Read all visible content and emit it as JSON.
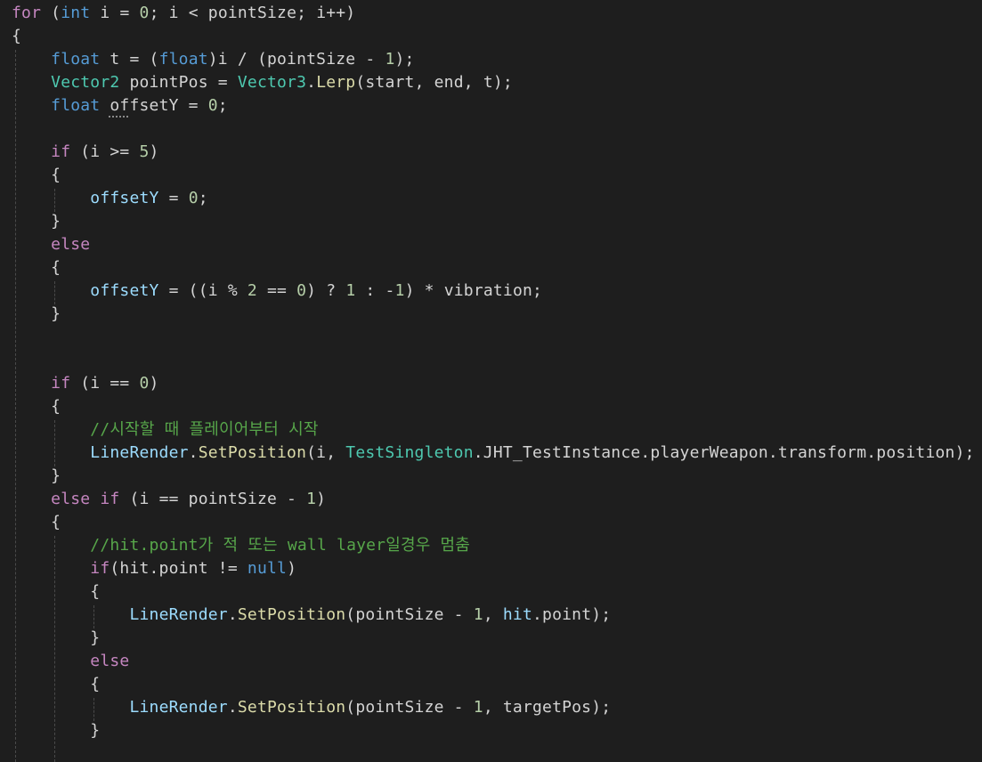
{
  "editor": {
    "lines": [
      [
        {
          "t": "for",
          "c": "ctl"
        },
        {
          "t": " (",
          "c": "txt"
        },
        {
          "t": "int",
          "c": "kw"
        },
        {
          "t": " i = ",
          "c": "txt"
        },
        {
          "t": "0",
          "c": "num"
        },
        {
          "t": "; i < pointSize; i++)",
          "c": "txt"
        }
      ],
      [
        {
          "t": "{",
          "c": "txt"
        }
      ],
      [
        {
          "t": "    ",
          "c": "txt"
        },
        {
          "t": "float",
          "c": "kw"
        },
        {
          "t": " t = (",
          "c": "txt"
        },
        {
          "t": "float",
          "c": "kw"
        },
        {
          "t": ")i / (pointSize - ",
          "c": "txt"
        },
        {
          "t": "1",
          "c": "num"
        },
        {
          "t": ");",
          "c": "txt"
        }
      ],
      [
        {
          "t": "    ",
          "c": "txt"
        },
        {
          "t": "Vector2",
          "c": "type"
        },
        {
          "t": " pointPos = ",
          "c": "txt"
        },
        {
          "t": "Vector3",
          "c": "type"
        },
        {
          "t": ".",
          "c": "txt"
        },
        {
          "t": "Lerp",
          "c": "fn"
        },
        {
          "t": "(start, end, t);",
          "c": "txt"
        }
      ],
      [
        {
          "t": "    ",
          "c": "txt"
        },
        {
          "t": "float",
          "c": "kw"
        },
        {
          "t": " offsetY = ",
          "c": "txt"
        },
        {
          "t": "0",
          "c": "num"
        },
        {
          "t": ";",
          "c": "txt"
        }
      ],
      [],
      [
        {
          "t": "    ",
          "c": "txt"
        },
        {
          "t": "if",
          "c": "ctl"
        },
        {
          "t": " (i >= ",
          "c": "txt"
        },
        {
          "t": "5",
          "c": "num"
        },
        {
          "t": ")",
          "c": "txt"
        }
      ],
      [
        {
          "t": "    {",
          "c": "txt"
        }
      ],
      [
        {
          "t": "        ",
          "c": "txt"
        },
        {
          "t": "offsetY",
          "c": "var"
        },
        {
          "t": " = ",
          "c": "txt"
        },
        {
          "t": "0",
          "c": "num"
        },
        {
          "t": ";",
          "c": "txt"
        }
      ],
      [
        {
          "t": "    }",
          "c": "txt"
        }
      ],
      [
        {
          "t": "    ",
          "c": "txt"
        },
        {
          "t": "else",
          "c": "ctl"
        }
      ],
      [
        {
          "t": "    {",
          "c": "txt"
        }
      ],
      [
        {
          "t": "        ",
          "c": "txt"
        },
        {
          "t": "offsetY",
          "c": "var"
        },
        {
          "t": " = ((i % ",
          "c": "txt"
        },
        {
          "t": "2",
          "c": "num"
        },
        {
          "t": " == ",
          "c": "txt"
        },
        {
          "t": "0",
          "c": "num"
        },
        {
          "t": ") ? ",
          "c": "txt"
        },
        {
          "t": "1",
          "c": "num"
        },
        {
          "t": " : -",
          "c": "txt"
        },
        {
          "t": "1",
          "c": "num"
        },
        {
          "t": ") * vibration;",
          "c": "txt"
        }
      ],
      [
        {
          "t": "    }",
          "c": "txt"
        }
      ],
      [],
      [],
      [
        {
          "t": "    ",
          "c": "txt"
        },
        {
          "t": "if",
          "c": "ctl"
        },
        {
          "t": " (i == ",
          "c": "txt"
        },
        {
          "t": "0",
          "c": "num"
        },
        {
          "t": ")",
          "c": "txt"
        }
      ],
      [
        {
          "t": "    {",
          "c": "txt"
        }
      ],
      [
        {
          "t": "        ",
          "c": "txt"
        },
        {
          "t": "//시작할 때 플레이어부터 시작",
          "c": "cm"
        }
      ],
      [
        {
          "t": "        ",
          "c": "txt"
        },
        {
          "t": "LineRender",
          "c": "var"
        },
        {
          "t": ".",
          "c": "txt"
        },
        {
          "t": "SetPosition",
          "c": "fn"
        },
        {
          "t": "(i, ",
          "c": "txt"
        },
        {
          "t": "TestSingleton",
          "c": "type"
        },
        {
          "t": ".JHT_TestInstance.playerWeapon.transform.position);",
          "c": "txt"
        }
      ],
      [
        {
          "t": "    }",
          "c": "txt"
        }
      ],
      [
        {
          "t": "    ",
          "c": "txt"
        },
        {
          "t": "else if",
          "c": "ctl"
        },
        {
          "t": " (i == pointSize - ",
          "c": "txt"
        },
        {
          "t": "1",
          "c": "num"
        },
        {
          "t": ")",
          "c": "txt"
        }
      ],
      [
        {
          "t": "    {",
          "c": "txt"
        }
      ],
      [
        {
          "t": "        ",
          "c": "txt"
        },
        {
          "t": "//hit.point가 적 또는 wall layer일경우 멈춤",
          "c": "cm"
        }
      ],
      [
        {
          "t": "        ",
          "c": "txt"
        },
        {
          "t": "if",
          "c": "ctl"
        },
        {
          "t": "(hit.point != ",
          "c": "txt"
        },
        {
          "t": "null",
          "c": "kw"
        },
        {
          "t": ")",
          "c": "txt"
        }
      ],
      [
        {
          "t": "        {",
          "c": "txt"
        }
      ],
      [
        {
          "t": "            ",
          "c": "txt"
        },
        {
          "t": "LineRender",
          "c": "var"
        },
        {
          "t": ".",
          "c": "txt"
        },
        {
          "t": "SetPosition",
          "c": "fn"
        },
        {
          "t": "(pointSize - ",
          "c": "txt"
        },
        {
          "t": "1",
          "c": "num"
        },
        {
          "t": ", ",
          "c": "txt"
        },
        {
          "t": "hit",
          "c": "var"
        },
        {
          "t": ".point);",
          "c": "txt"
        }
      ],
      [
        {
          "t": "        }",
          "c": "txt"
        }
      ],
      [
        {
          "t": "        ",
          "c": "txt"
        },
        {
          "t": "else",
          "c": "ctl"
        }
      ],
      [
        {
          "t": "        {",
          "c": "txt"
        }
      ],
      [
        {
          "t": "            ",
          "c": "txt"
        },
        {
          "t": "LineRender",
          "c": "var"
        },
        {
          "t": ".",
          "c": "txt"
        },
        {
          "t": "SetPosition",
          "c": "fn"
        },
        {
          "t": "(pointSize - ",
          "c": "txt"
        },
        {
          "t": "1",
          "c": "num"
        },
        {
          "t": ", targetPos);",
          "c": "txt"
        }
      ],
      [
        {
          "t": "        }",
          "c": "txt"
        }
      ]
    ]
  },
  "colors": {
    "background": "#1e1e1e",
    "keyword": "#569cd6",
    "control": "#c586c0",
    "type": "#4ec9b0",
    "function": "#dcdcaa",
    "variable": "#9cdcfe",
    "number": "#b5cea8",
    "comment": "#57a64a",
    "text": "#d4d4d4"
  }
}
